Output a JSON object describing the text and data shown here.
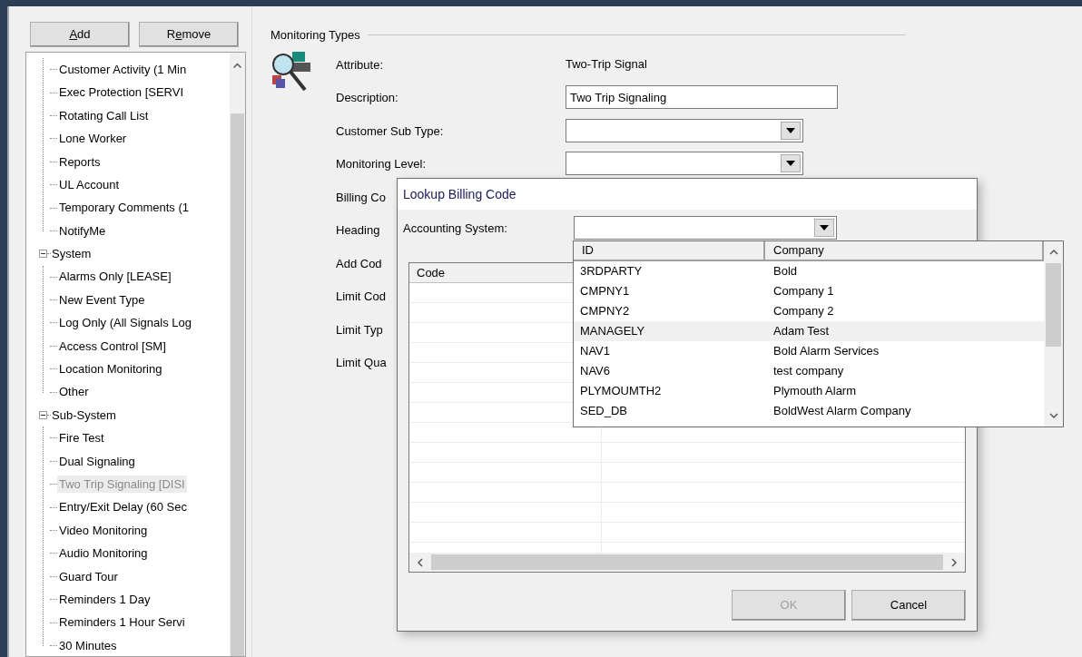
{
  "left_panel": {
    "buttons": [
      {
        "key": "A",
        "after": "dd"
      },
      {
        "before": "R",
        "key": "e",
        "after": "move"
      }
    ],
    "tree": [
      {
        "children": [
          {
            "label": "Customer Activity (1 Min",
            "selected": false
          },
          {
            "label": "Exec Protection [SERVI",
            "selected": false
          },
          {
            "label": "Rotating Call List",
            "selected": false
          },
          {
            "label": "Lone Worker",
            "selected": false
          },
          {
            "label": "Reports",
            "selected": false
          },
          {
            "label": "UL Account",
            "selected": false
          },
          {
            "label": "Temporary Comments (1",
            "selected": false
          },
          {
            "label": "NotifyMe",
            "selected": false
          }
        ]
      },
      {
        "label": "System",
        "expanded": true,
        "children": [
          {
            "label": "Alarms Only [LEASE]",
            "selected": false
          },
          {
            "label": "New Event Type",
            "selected": false
          },
          {
            "label": "Log Only (All Signals Log",
            "selected": false
          },
          {
            "label": "Access Control [SM]",
            "selected": false
          },
          {
            "label": "Location Monitoring",
            "selected": false
          },
          {
            "label": "Other",
            "selected": false
          }
        ]
      },
      {
        "label": "Sub-System",
        "expanded": true,
        "children": [
          {
            "label": "Fire Test",
            "selected": false
          },
          {
            "label": "Dual Signaling",
            "selected": false
          },
          {
            "label": "Two Trip Signaling [DISI",
            "selected": true
          },
          {
            "label": "Entry/Exit Delay (60 Sec",
            "selected": false
          },
          {
            "label": "Video Monitoring",
            "selected": false
          },
          {
            "label": "Audio Monitoring",
            "selected": false
          },
          {
            "label": "Guard Tour",
            "selected": false
          },
          {
            "label": "Reminders 1 Day",
            "selected": false
          },
          {
            "label": "Reminders 1 Hour Servi",
            "selected": false
          },
          {
            "label": "30 Minutes",
            "selected": false
          }
        ]
      }
    ]
  },
  "form": {
    "title": "Monitoring Types",
    "rows": [
      {
        "label": "Attribute:",
        "kind": "text",
        "value": "Two-Trip Signal"
      },
      {
        "label": "Description:",
        "kind": "field",
        "value": "Two Trip Signaling"
      },
      {
        "label": "Customer Sub Type:",
        "kind": "combo"
      },
      {
        "label": "Monitoring Level:",
        "kind": "combo"
      },
      {
        "label": "Billing Co",
        "kind": "label"
      },
      {
        "label": "Heading",
        "kind": "label"
      },
      {
        "label": "Add Cod",
        "kind": "label"
      },
      {
        "label": "Limit Cod",
        "kind": "label"
      },
      {
        "label": "Limit Typ",
        "kind": "label"
      },
      {
        "label": "Limit Qua",
        "kind": "label"
      }
    ]
  },
  "dialog": {
    "title": "Lookup Billing Code",
    "accounting_label": "Accounting System:",
    "grid_columns": [
      "Code"
    ],
    "buttons": [
      {
        "label": "OK",
        "disabled": true
      },
      {
        "label": "Cancel",
        "disabled": false
      }
    ]
  },
  "dropdown": {
    "columns": [
      "ID",
      "Company"
    ],
    "rows": [
      {
        "id": "3RDPARTY",
        "company": "Bold",
        "selected": false
      },
      {
        "id": "CMPNY1",
        "company": "Company 1",
        "selected": false
      },
      {
        "id": "CMPNY2",
        "company": "Company 2",
        "selected": false
      },
      {
        "id": "MANAGELY",
        "company": "Adam Test",
        "selected": true
      },
      {
        "id": "NAV1",
        "company": "Bold Alarm Services",
        "selected": false
      },
      {
        "id": "NAV6",
        "company": "test company",
        "selected": false
      },
      {
        "id": "PLYMOUMTH2",
        "company": "Plymouth Alarm",
        "selected": false
      },
      {
        "id": "SED_DB",
        "company": "BoldWest Alarm Company",
        "selected": false
      }
    ]
  }
}
